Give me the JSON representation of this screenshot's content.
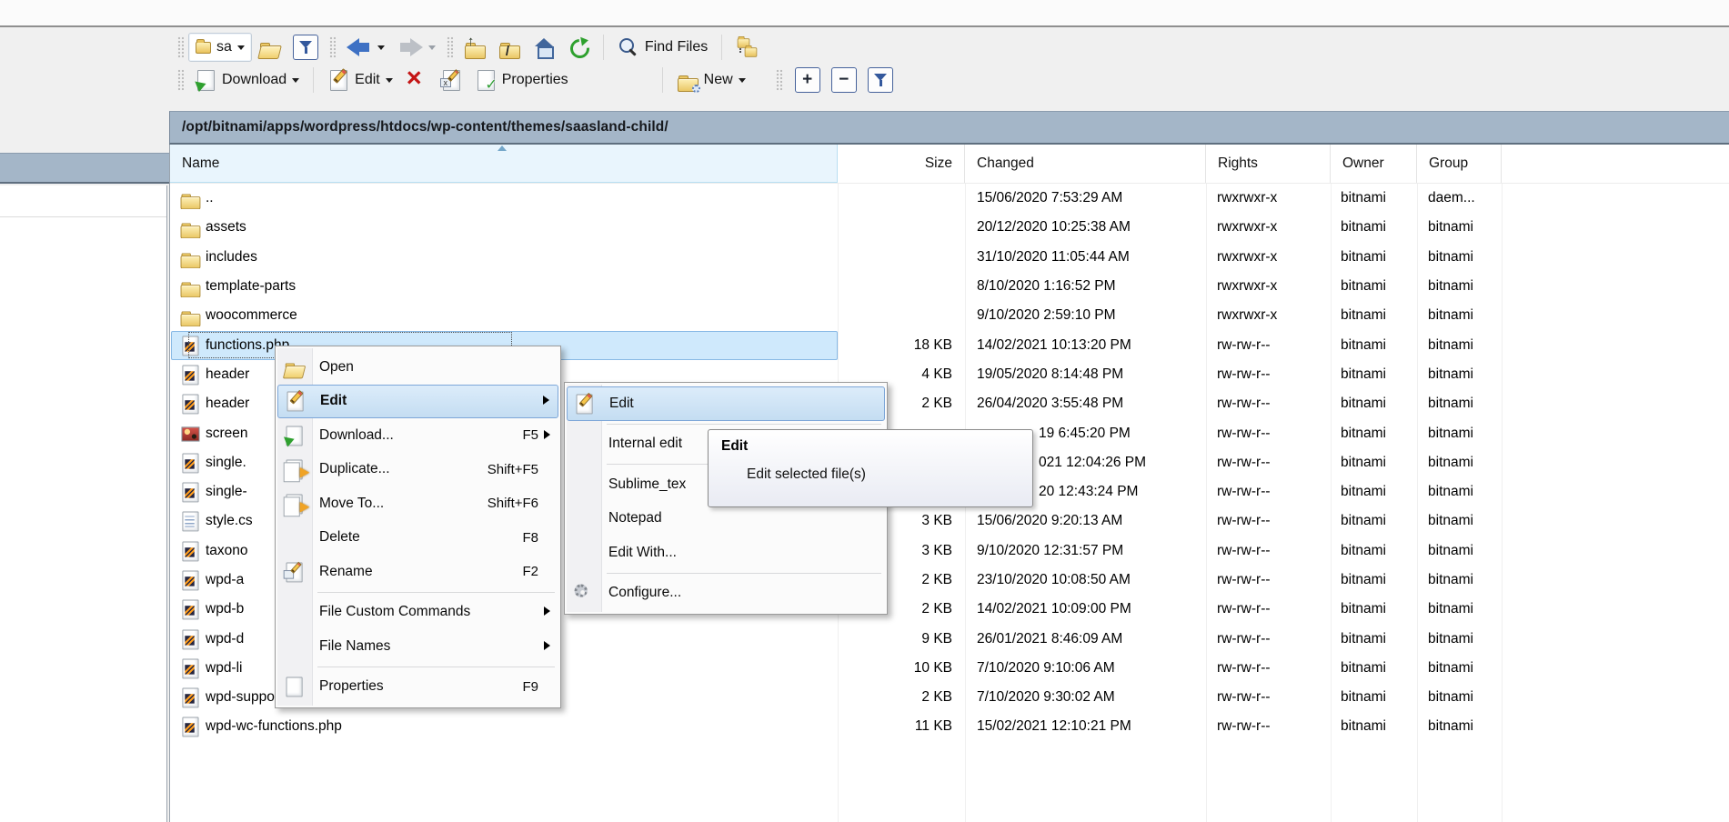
{
  "path_bar": {
    "path": "/opt/bitnami/apps/wordpress/htdocs/wp-content/themes/saasland-child/"
  },
  "toolbar_main": {
    "session_label": "sa",
    "find_files_label": "Find Files"
  },
  "toolbar_commands": {
    "download_label": "Download",
    "edit_label": "Edit",
    "properties_label": "Properties",
    "new_label": "New",
    "plus_label": "+",
    "minus_label": "−"
  },
  "file_table": {
    "columns": {
      "name": "Name",
      "size": "Size",
      "changed": "Changed",
      "rights": "Rights",
      "owner": "Owner",
      "group": "Group"
    },
    "rows": [
      {
        "name": "..",
        "icon": "folder-up",
        "size": "",
        "changed": "15/06/2020 7:53:29 AM",
        "rights": "rwxrwxr-x",
        "owner": "bitnami",
        "group": "daem..."
      },
      {
        "name": "assets",
        "icon": "folder",
        "size": "",
        "changed": "20/12/2020 10:25:38 AM",
        "rights": "rwxrwxr-x",
        "owner": "bitnami",
        "group": "bitnami"
      },
      {
        "name": "includes",
        "icon": "folder",
        "size": "",
        "changed": "31/10/2020 11:05:44 AM",
        "rights": "rwxrwxr-x",
        "owner": "bitnami",
        "group": "bitnami"
      },
      {
        "name": "template-parts",
        "icon": "folder",
        "size": "",
        "changed": "8/10/2020 1:16:52 PM",
        "rights": "rwxrwxr-x",
        "owner": "bitnami",
        "group": "bitnami"
      },
      {
        "name": "woocommerce",
        "icon": "folder",
        "size": "",
        "changed": "9/10/2020 2:59:10 PM",
        "rights": "rwxrwxr-x",
        "owner": "bitnami",
        "group": "bitnami"
      },
      {
        "name": "functions.php",
        "icon": "php",
        "size": "18 KB",
        "changed": "14/02/2021 10:13:20 PM",
        "rights": "rw-rw-r--",
        "owner": "bitnami",
        "group": "bitnami",
        "classes": "selected"
      },
      {
        "name": "header",
        "icon": "php",
        "size": "4 KB",
        "changed": "19/05/2020 8:14:48 PM",
        "rights": "rw-rw-r--",
        "owner": "bitnami",
        "group": "bitnami"
      },
      {
        "name": "header",
        "icon": "php",
        "size": "2 KB",
        "changed": "26/04/2020 3:55:48 PM",
        "rights": "rw-rw-r--",
        "owner": "bitnami",
        "group": "bitnami"
      },
      {
        "name": "screen",
        "icon": "image",
        "size": "",
        "changed": "19 6:45:20 PM",
        "rights": "rw-rw-r--",
        "owner": "bitnami",
        "group": "bitnami",
        "classes": "occluded"
      },
      {
        "name": "single.",
        "icon": "php",
        "size": "",
        "changed": "021 12:04:26 PM",
        "rights": "rw-rw-r--",
        "owner": "bitnami",
        "group": "bitnami",
        "classes": "occluded"
      },
      {
        "name": "single-",
        "icon": "php",
        "size": "",
        "changed": "20 12:43:24 PM",
        "rights": "rw-rw-r--",
        "owner": "bitnami",
        "group": "bitnami",
        "classes": "occluded"
      },
      {
        "name": "style.cs",
        "icon": "css",
        "size": "3 KB",
        "changed": "15/06/2020 9:20:13 AM",
        "rights": "rw-rw-r--",
        "owner": "bitnami",
        "group": "bitnami"
      },
      {
        "name": "taxono",
        "icon": "php",
        "size": "3 KB",
        "changed": "9/10/2020 12:31:57 PM",
        "rights": "rw-rw-r--",
        "owner": "bitnami",
        "group": "bitnami"
      },
      {
        "name": "wpd-a",
        "icon": "php",
        "size": "2 KB",
        "changed": "23/10/2020 10:08:50 AM",
        "rights": "rw-rw-r--",
        "owner": "bitnami",
        "group": "bitnami"
      },
      {
        "name": "wpd-b",
        "icon": "php",
        "size": "2 KB",
        "changed": "14/02/2021 10:09:00 PM",
        "rights": "rw-rw-r--",
        "owner": "bitnami",
        "group": "bitnami"
      },
      {
        "name": "wpd-d",
        "icon": "php",
        "size": "9 KB",
        "changed": "26/01/2021 8:46:09 AM",
        "rights": "rw-rw-r--",
        "owner": "bitnami",
        "group": "bitnami"
      },
      {
        "name": "wpd-li",
        "icon": "php",
        "size": "10 KB",
        "changed": "7/10/2020 9:10:06 AM",
        "rights": "rw-rw-r--",
        "owner": "bitnami",
        "group": "bitnami"
      },
      {
        "name": "wpd-support-manager.php",
        "icon": "php",
        "size": "2 KB",
        "changed": "7/10/2020 9:30:02 AM",
        "rights": "rw-rw-r--",
        "owner": "bitnami",
        "group": "bitnami"
      },
      {
        "name": "wpd-wc-functions.php",
        "icon": "php",
        "size": "11 KB",
        "changed": "15/02/2021 12:10:21 PM",
        "rights": "rw-rw-r--",
        "owner": "bitnami",
        "group": "bitnami"
      }
    ]
  },
  "context_menu": {
    "items": [
      {
        "icon": "open-folder",
        "label": "Open"
      },
      {
        "icon": "edit",
        "label": "Edit",
        "classes": "highlighted bold has-sub"
      },
      {
        "icon": "download",
        "label": "Download...",
        "shortcut": "F5",
        "classes": "has-sub"
      },
      {
        "icon": "duplicate",
        "label": "Duplicate...",
        "shortcut": "Shift+F5"
      },
      {
        "icon": "move",
        "label": "Move To...",
        "shortcut": "Shift+F6"
      },
      {
        "icon": "delete",
        "label": "Delete",
        "shortcut": "F8"
      },
      {
        "icon": "rename",
        "label": "Rename",
        "shortcut": "F2"
      },
      {
        "classes": "separator"
      },
      {
        "label": "File Custom Commands",
        "classes": "has-sub"
      },
      {
        "label": "File Names",
        "classes": "has-sub"
      },
      {
        "classes": "separator"
      },
      {
        "icon": "properties",
        "label": "Properties",
        "shortcut": "F9"
      }
    ]
  },
  "edit_submenu": {
    "items": [
      {
        "icon": "edit",
        "label": "Edit",
        "classes": "highlighted"
      },
      {
        "classes": "separator"
      },
      {
        "label": "Internal edit"
      },
      {
        "classes": "separator"
      },
      {
        "label": "Sublime_tex"
      },
      {
        "label": "Notepad"
      },
      {
        "label": "Edit With..."
      },
      {
        "classes": "separator"
      },
      {
        "icon": "gear",
        "label": "Configure..."
      }
    ]
  },
  "tooltip": {
    "title": "Edit",
    "description": "Edit selected file(s)"
  },
  "colors": {
    "path_bar_bg": "#a4b6c8",
    "selection_bg": "#cfe9fc",
    "selection_border": "#88b9e5",
    "menu_highlight_border": "#7da6d8",
    "sorted_header_bg": "#e9f5fd",
    "delete_red": "#c41515",
    "folder_yellow": "#eac765",
    "refresh_green": "#2ea02e",
    "nav_blue": "#3e71c4"
  }
}
